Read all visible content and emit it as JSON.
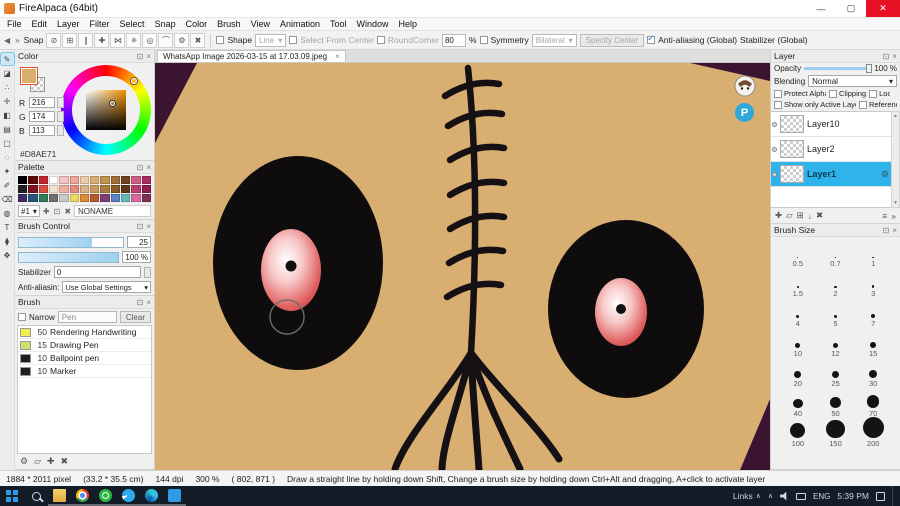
{
  "window": {
    "title": "FireAlpaca (64bit)",
    "minimize": "—",
    "maximize": "▢",
    "close": "✕"
  },
  "ui": {
    "caret": "▾",
    "close": "×",
    "dock": "⊡",
    "gear": "⚙",
    "arrow_up": "▲",
    "arrow_down": "▼",
    "chevron_up": "∧"
  },
  "menu": {
    "items": [
      "File",
      "Edit",
      "Layer",
      "Filter",
      "Select",
      "Snap",
      "Color",
      "Brush",
      "View",
      "Animation",
      "Tool",
      "Window",
      "Help"
    ]
  },
  "toolbar": {
    "back": "◀",
    "more": "»",
    "snap_label": "Snap",
    "snap_icons": [
      {
        "name": "snap-off-icon",
        "glyph": "⊘"
      },
      {
        "name": "snap-grid-icon",
        "glyph": "⊞"
      },
      {
        "name": "snap-parallel-icon",
        "glyph": "∥"
      },
      {
        "name": "snap-cross-icon",
        "glyph": "✚"
      },
      {
        "name": "snap-vanishing-icon",
        "glyph": "⋈"
      },
      {
        "name": "snap-radial-icon",
        "glyph": "✳"
      },
      {
        "name": "snap-ellipse-icon",
        "glyph": "◎"
      },
      {
        "name": "snap-curve-icon",
        "glyph": "⌒"
      },
      {
        "name": "snap-settings-icon",
        "glyph": "⚙"
      },
      {
        "name": "snap-clear-icon",
        "glyph": "✖"
      }
    ],
    "shape_label": "Shape",
    "shape_value": "Line",
    "select_from_center": "Select From Center",
    "round_corner_label": "RoundCorner",
    "round_corner_value": "80",
    "percent": "%",
    "symmetry_label": "Symmetry",
    "symmetry_value": "Bilateral",
    "specify_center": "Specify Center",
    "anti_aliasing": "Anti-aliasing (Global)",
    "stabilizer": "Stabilizer (Global)"
  },
  "tools": {
    "items": [
      {
        "name": "brush-tool",
        "glyph": "✎",
        "active": true
      },
      {
        "name": "eraser-tool",
        "glyph": "◪"
      },
      {
        "name": "dot-tool",
        "glyph": "∴"
      },
      {
        "name": "move-tool",
        "glyph": "✛"
      },
      {
        "name": "fill-tool",
        "glyph": "◧"
      },
      {
        "name": "gradient-tool",
        "glyph": "▤"
      },
      {
        "name": "select-tool",
        "glyph": "▢"
      },
      {
        "name": "lasso-tool",
        "glyph": "◌"
      },
      {
        "name": "magic-wand-tool",
        "glyph": "✦"
      },
      {
        "name": "select-pen-tool",
        "glyph": "✐"
      },
      {
        "name": "select-eraser-tool",
        "glyph": "⌫"
      },
      {
        "name": "bucket-tool",
        "glyph": "◍"
      },
      {
        "name": "text-tool",
        "glyph": "T"
      },
      {
        "name": "eyedropper-tool",
        "glyph": "⧫"
      },
      {
        "name": "hand-tool",
        "glyph": "✥"
      }
    ]
  },
  "color_panel": {
    "title": "Color",
    "r_label": "R",
    "r_value": "216",
    "g_label": "G",
    "g_value": "174",
    "b_label": "B",
    "b_value": "113",
    "hex": "#D8AE71",
    "current_color": "#D8AE71",
    "secondary_color": "#FFFFFF"
  },
  "palette_panel": {
    "title": "Palette",
    "page": "#1",
    "name": "NONAME",
    "footer_icons": [
      {
        "name": "palette-add-icon",
        "glyph": "✚"
      },
      {
        "name": "palette-replace-icon",
        "glyph": "⊡"
      },
      {
        "name": "palette-delete-icon",
        "glyph": "✖"
      }
    ],
    "swatches": [
      "#000000",
      "#5f0a0a",
      "#c1272d",
      "#ffffff",
      "#f6c3c3",
      "#f2a39b",
      "#eccba6",
      "#d8ae71",
      "#c2924f",
      "#9f6d36",
      "#71441f",
      "#cf5c82",
      "#a62c63",
      "#1f1f1f",
      "#7e1220",
      "#dd4b3e",
      "#f4e3cf",
      "#efae9e",
      "#e58d7c",
      "#d9b183",
      "#c99a5c",
      "#ad7b3f",
      "#8a5a28",
      "#5f3516",
      "#bb3f6d",
      "#8f1d50",
      "#3d2b66",
      "#27557e",
      "#2f7d55",
      "#6f6f6f",
      "#c9c9c9",
      "#efd95a",
      "#df8c3a",
      "#b85a2b",
      "#7e3f78",
      "#5a82c4",
      "#66b8b8",
      "#d9699b",
      "#7e3350"
    ]
  },
  "brush_control": {
    "title": "Brush Control",
    "size_value": "25",
    "opacity_value": "100 %",
    "stabilizer_label": "Stabilizer",
    "stabilizer_value": "0",
    "aa_label": "Anti-aliasin:",
    "aa_value": "Use Global Settings"
  },
  "brush_panel": {
    "title": "Brush",
    "narrow_label": "Narrow",
    "filter_value": "Pen",
    "clear_label": "Clear",
    "brushes": [
      {
        "size": "50",
        "name": "Rendering Handwriting",
        "color": "#f3ed4e"
      },
      {
        "size": "15",
        "name": "Drawing Pen",
        "color": "#cde26a"
      },
      {
        "size": "10",
        "name": "Ballpoint pen",
        "color": "#1d1d1d"
      },
      {
        "size": "10",
        "name": "Marker",
        "color": "#1d1d1d"
      }
    ],
    "footer_icons": [
      {
        "name": "brush-settings-icon",
        "glyph": "⚙"
      },
      {
        "name": "brush-folder-icon",
        "glyph": "▱"
      },
      {
        "name": "brush-add-icon",
        "glyph": "✚"
      },
      {
        "name": "brush-delete-icon",
        "glyph": "✖"
      }
    ]
  },
  "canvas": {
    "tab": "WhatsApp Image 2026-03-15 at 17.03.09.jpeg",
    "p_badge": "P"
  },
  "layer_panel": {
    "title": "Layer",
    "opacity_label": "Opacity",
    "opacity_value": "100 %",
    "blending_label": "Blending",
    "blending_value": "Normal",
    "checkboxes_row1": [
      "Protect Alpha",
      "Clipping",
      "Lock"
    ],
    "checkboxes_row2": [
      "Show only Active Layer",
      "Reference"
    ],
    "layers": [
      {
        "name": "Layer10",
        "active": false
      },
      {
        "name": "Layer2",
        "active": false
      },
      {
        "name": "Layer1",
        "active": true
      }
    ],
    "footer_icons": [
      {
        "name": "add-layer-icon",
        "glyph": "✚"
      },
      {
        "name": "layer-folder-icon",
        "glyph": "▱"
      },
      {
        "name": "duplicate-layer-icon",
        "glyph": "⊞"
      },
      {
        "name": "merge-down-icon",
        "glyph": "↓"
      },
      {
        "name": "delete-layer-icon",
        "glyph": "✖"
      }
    ],
    "footer_right_icons": [
      {
        "name": "layer-menu-icon",
        "glyph": "≡"
      },
      {
        "name": "layer-overflow-icon",
        "glyph": "»"
      }
    ]
  },
  "brush_size_panel": {
    "title": "Brush Size",
    "sizes": [
      "0.5",
      "0.7",
      "1",
      "1.5",
      "2",
      "3",
      "4",
      "5",
      "7",
      "10",
      "12",
      "15",
      "20",
      "25",
      "30",
      "40",
      "50",
      "70",
      "100",
      "150",
      "200"
    ]
  },
  "status_bar": {
    "dimensions": "1884 * 2011 pixel",
    "print_size": "(33.2 * 35.5 cm)",
    "dpi": "144 dpi",
    "zoom": "300 %",
    "cursor": "( 802, 871 )",
    "hint": "Draw a straight line by holding down Shift, Change a brush size by holding down Ctrl+Alt and dragging, A+click to activate layer"
  },
  "taskbar": {
    "links_label": "Links",
    "language": "ENG",
    "time": "5:39 PM",
    "apps": [
      {
        "name": "file-explorer-icon",
        "class": "ic-folder"
      },
      {
        "name": "chrome-icon",
        "class": "ic-chrome"
      },
      {
        "name": "whatsapp-icon",
        "class": "ic-whatsapp"
      },
      {
        "name": "telegram-icon",
        "class": "ic-telegram"
      },
      {
        "name": "edge-icon",
        "class": "ic-edge"
      },
      {
        "name": "vscode-icon",
        "class": "ic-vscode"
      }
    ]
  }
}
